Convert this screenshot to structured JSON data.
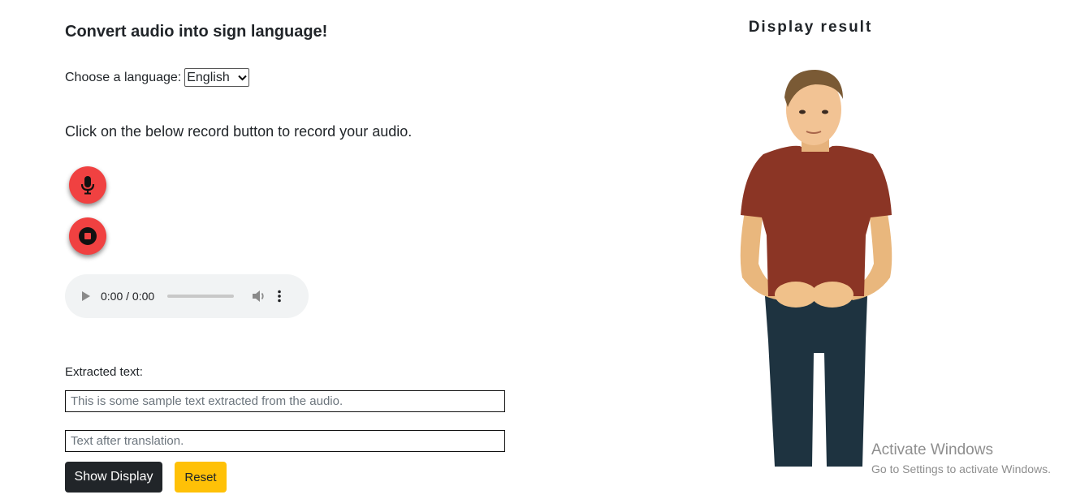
{
  "left_panel": {
    "heading": "Convert audio into sign language!",
    "language_label": "Choose a language:",
    "language_selected": "English",
    "instructions": "Click on the below record button to record your audio.",
    "record_icon": "microphone-icon",
    "stop_icon": "stop-icon",
    "record_color": "#f04141"
  },
  "audio_player": {
    "time": "0:00 / 0:00",
    "progress": 0
  },
  "extracted": {
    "label": "Extracted text:",
    "text_placeholder": "This is some sample text extracted from the audio.",
    "translation_placeholder": "Text after translation."
  },
  "actions": {
    "show_display": "Show Display",
    "reset": "Reset",
    "show_display_color": "#212529",
    "reset_color": "#ffc107"
  },
  "right_panel": {
    "title": "Display result"
  },
  "watermark": {
    "line1": "Activate Windows",
    "line2": "Go to Settings to activate Windows."
  }
}
